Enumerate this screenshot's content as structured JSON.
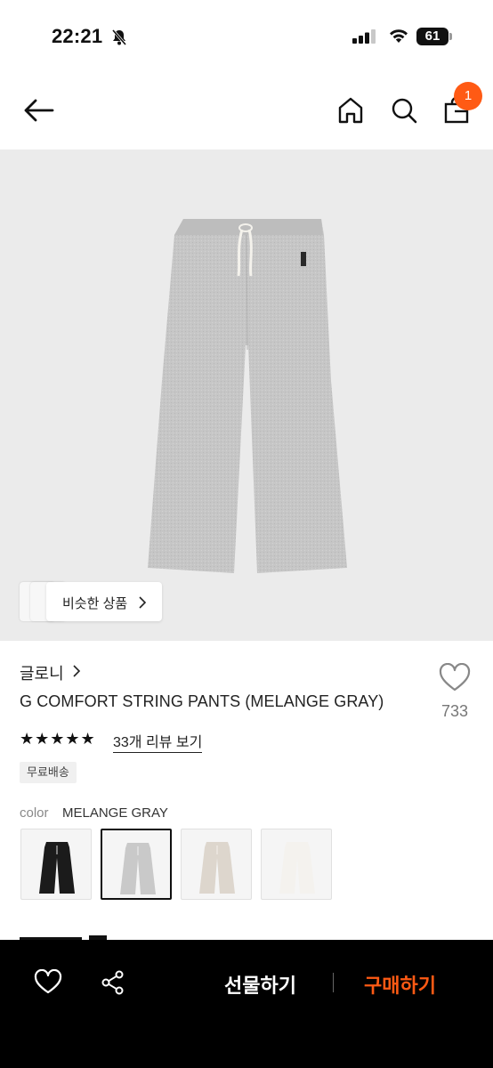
{
  "status_bar": {
    "time": "22:21",
    "battery": "61"
  },
  "header": {
    "cart_badge": "1"
  },
  "hero": {
    "similar_label": "비슷한 상품"
  },
  "product": {
    "brand": "글로니",
    "title": "G COMFORT STRING PANTS (MELANGE GRAY)",
    "likes": "733",
    "stars": "★★★★★",
    "review_link": "33개 리뷰 보기",
    "tag": "무료배송",
    "color_label": "color",
    "color_value": "MELANGE GRAY",
    "swatches": [
      {
        "name": "black",
        "color": "#1b1b1b"
      },
      {
        "name": "melange-gray",
        "color": "#c9c9c9",
        "selected": true
      },
      {
        "name": "oatmeal",
        "color": "#ddd6cd"
      },
      {
        "name": "ivory",
        "color": "#f4f2ee"
      }
    ]
  },
  "bottom_bar": {
    "gift_label": "선물하기",
    "buy_label": "구매하기"
  },
  "colors": {
    "accent": "#ff5a14",
    "bottom_bar": "#000000"
  }
}
